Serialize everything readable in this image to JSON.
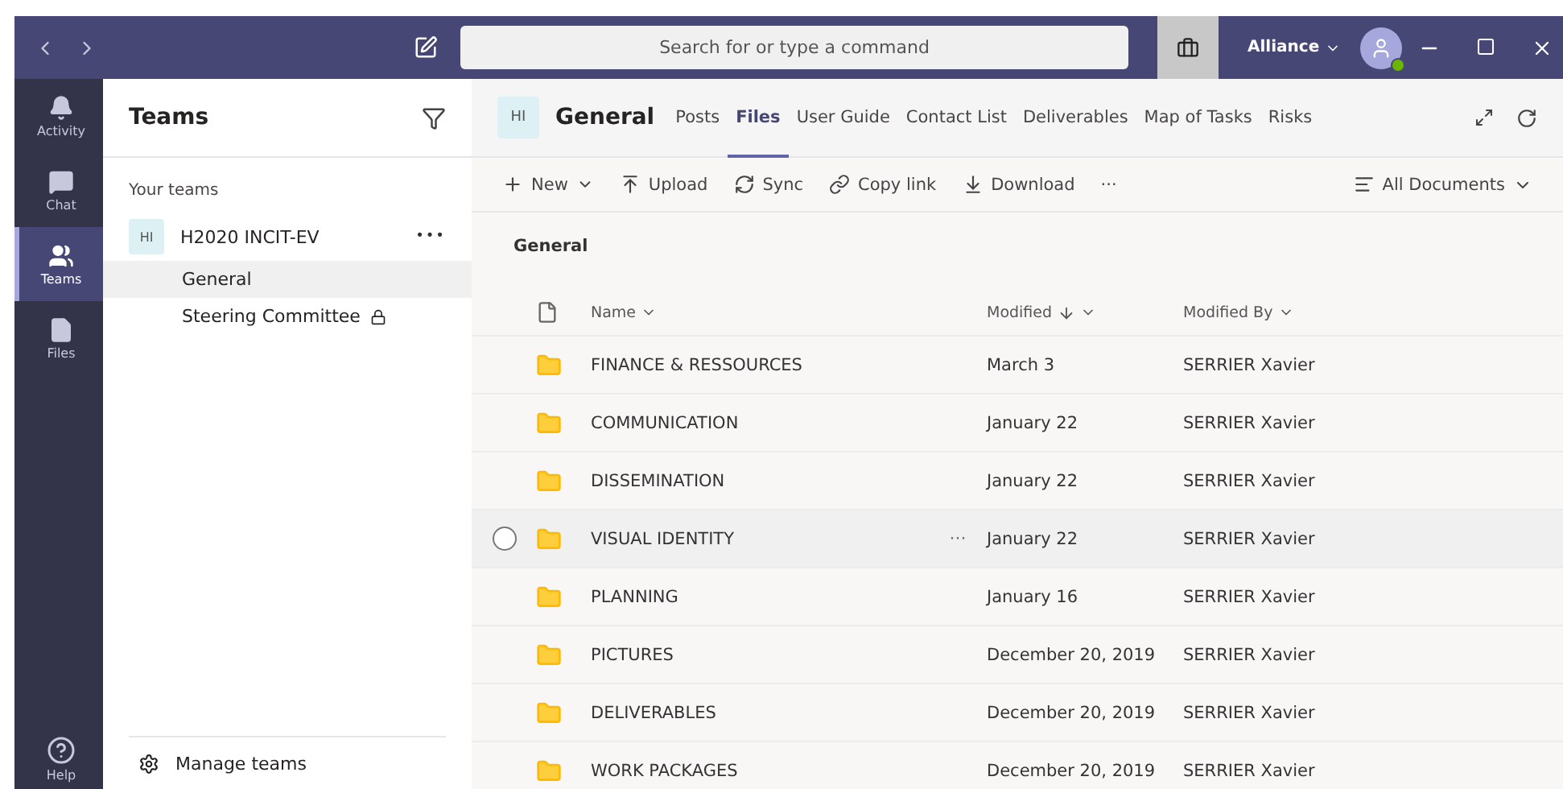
{
  "top_bar": {
    "search": {
      "placeholder": "Search for or type a command"
    },
    "org": "Alliance"
  },
  "rail": [
    {
      "label": "Activity",
      "kind": "activity",
      "selected": false
    },
    {
      "label": "Chat",
      "kind": "chat",
      "selected": false
    },
    {
      "label": "Teams",
      "kind": "teams",
      "selected": true
    },
    {
      "label": "Files",
      "kind": "files",
      "selected": false
    }
  ],
  "rail_bottom": {
    "label": "Help"
  },
  "sidebar": {
    "title": "Teams",
    "section": "Your teams",
    "team": {
      "avatar": "HI",
      "name": "H2020 INCIT-EV",
      "more": "•••"
    },
    "channels": [
      {
        "name": "General",
        "selected": true,
        "locked": false
      },
      {
        "name": "Steering Committee",
        "selected": false,
        "locked": true
      }
    ],
    "footer": "Manage teams"
  },
  "header": {
    "avatar": "HI",
    "title": "General",
    "tabs": [
      {
        "label": "Posts",
        "selected": false
      },
      {
        "label": "Files",
        "selected": true
      },
      {
        "label": "User Guide",
        "selected": false
      },
      {
        "label": "Contact List",
        "selected": false
      },
      {
        "label": "Deliverables",
        "selected": false
      },
      {
        "label": "Map of Tasks",
        "selected": false
      },
      {
        "label": "Risks",
        "selected": false
      }
    ]
  },
  "toolbar": {
    "actions": [
      {
        "label": "New",
        "kind": "new"
      },
      {
        "label": "Upload",
        "kind": "upload"
      },
      {
        "label": "Sync",
        "kind": "sync"
      },
      {
        "label": "Copy link",
        "kind": "link"
      },
      {
        "label": "Download",
        "kind": "download"
      }
    ],
    "more": "···",
    "view": "All Documents"
  },
  "breadcrumb": "General",
  "table": {
    "columns": [
      "Name",
      "Modified",
      "Modified By"
    ],
    "rows": [
      {
        "name": "FINANCE & RESSOURCES",
        "modified": "March 3",
        "by": "SERRIER Xavier",
        "hovered": false
      },
      {
        "name": "COMMUNICATION",
        "modified": "January 22",
        "by": "SERRIER Xavier",
        "hovered": false
      },
      {
        "name": "DISSEMINATION",
        "modified": "January 22",
        "by": "SERRIER Xavier",
        "hovered": false
      },
      {
        "name": "VISUAL IDENTITY",
        "modified": "January 22",
        "by": "SERRIER Xavier",
        "hovered": true
      },
      {
        "name": "PLANNING",
        "modified": "January 16",
        "by": "SERRIER Xavier",
        "hovered": false
      },
      {
        "name": "PICTURES",
        "modified": "December 20, 2019",
        "by": "SERRIER Xavier",
        "hovered": false
      },
      {
        "name": "DELIVERABLES",
        "modified": "December 20, 2019",
        "by": "SERRIER Xavier",
        "hovered": false
      },
      {
        "name": "WORK PACKAGES",
        "modified": "December 20, 2019",
        "by": "SERRIER Xavier",
        "hovered": false
      }
    ],
    "row_more": "···"
  }
}
